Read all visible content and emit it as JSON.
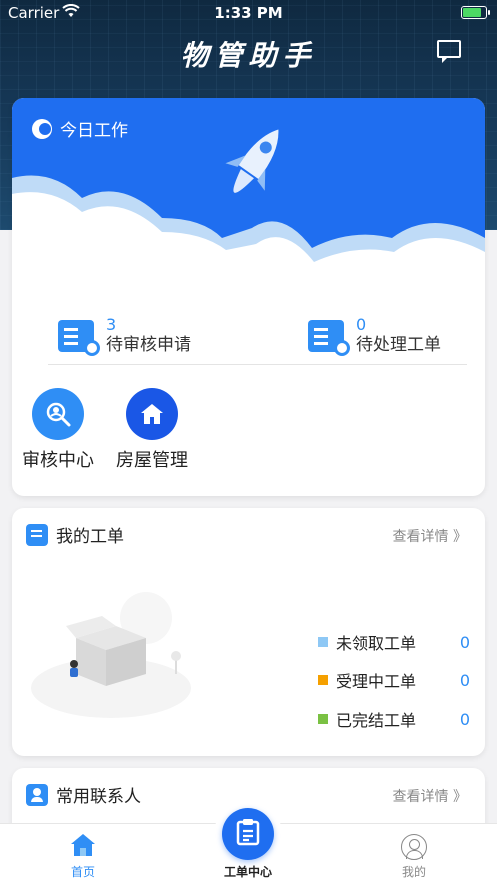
{
  "status_bar": {
    "carrier": "Carrier",
    "time": "1:33 PM"
  },
  "header": {
    "title": "物管助手",
    "message_icon": "message-icon"
  },
  "today": {
    "title": "今日工作",
    "stats": [
      {
        "value": "3",
        "label": "待审核申请",
        "icon": "review-list-icon"
      },
      {
        "value": "0",
        "label": "待处理工单",
        "icon": "pending-order-icon"
      }
    ],
    "quick_actions": [
      {
        "label": "审核中心",
        "icon": "review-search-icon",
        "color": "#2f8ef5"
      },
      {
        "label": "房屋管理",
        "icon": "house-icon",
        "color": "#1a57e6"
      }
    ]
  },
  "my_orders": {
    "title": "我的工单",
    "link": "查看详情 》",
    "legend": [
      {
        "label": "未领取工单",
        "value": "0",
        "color": "#8ec8f5"
      },
      {
        "label": "受理中工单",
        "value": "0",
        "color": "#f5a000"
      },
      {
        "label": "已完结工单",
        "value": "0",
        "color": "#7ac143"
      }
    ]
  },
  "contacts": {
    "title": "常用联系人",
    "link": "查看详情 》"
  },
  "tabbar": {
    "items": [
      {
        "label": "首页",
        "icon": "home-icon",
        "active": true
      },
      {
        "label": "工单中心",
        "icon": "clipboard-icon",
        "active": false
      },
      {
        "label": "我的",
        "icon": "user-icon",
        "active": false
      }
    ]
  },
  "colors": {
    "primary": "#1f6ef0",
    "accent": "#2f8ef5",
    "header_bg": "#173a5a"
  }
}
